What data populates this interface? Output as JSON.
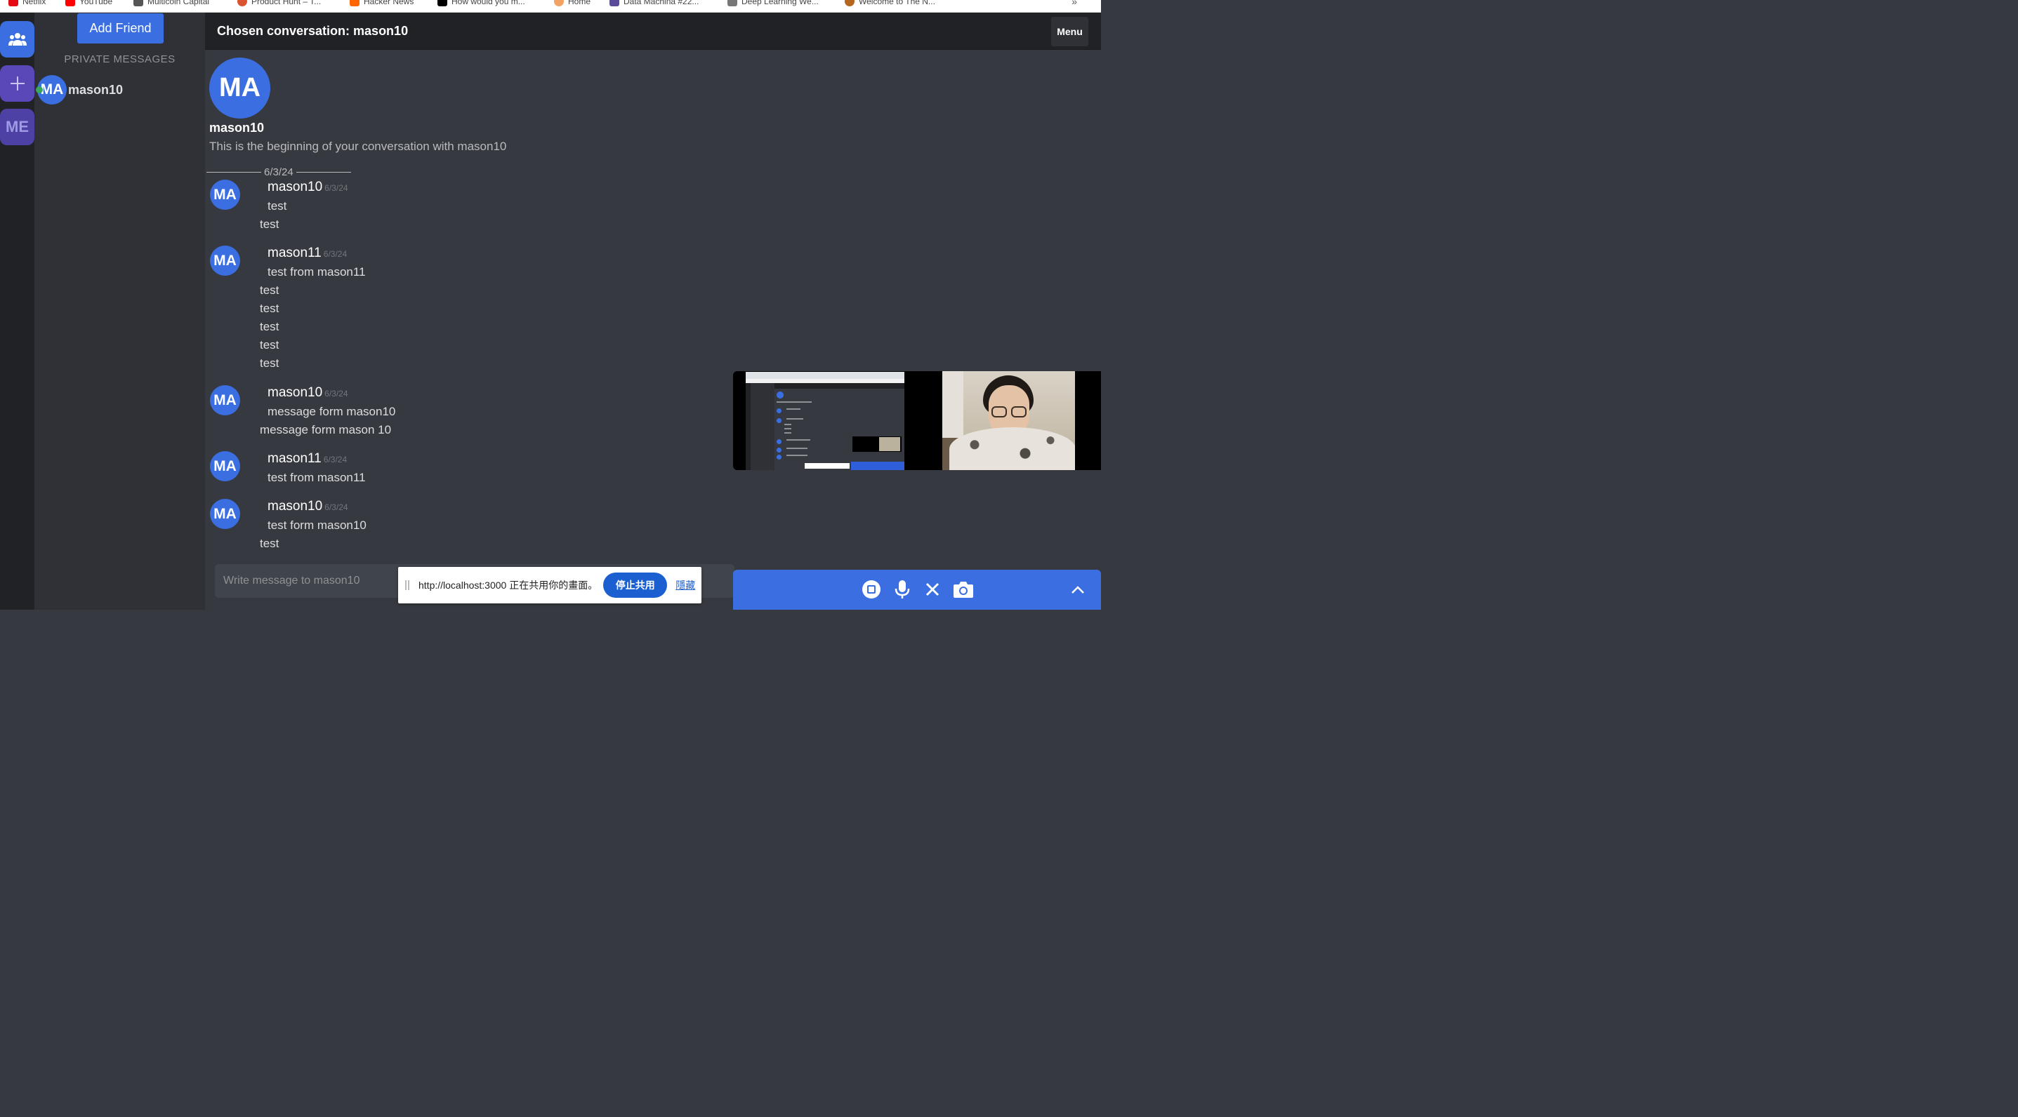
{
  "bookmarks": [
    {
      "label": "Netflix",
      "icon": "netflix-icon",
      "color": "#e50914"
    },
    {
      "label": "YouTube",
      "icon": "youtube-icon",
      "color": "#ff0000"
    },
    {
      "label": "Multicoin Capital",
      "icon": "multicoin-icon",
      "color": "#555555"
    },
    {
      "label": "Product Hunt – T...",
      "icon": "producthunt-icon",
      "color": "#da552f"
    },
    {
      "label": "Hacker News",
      "icon": "hackernews-icon",
      "color": "#ff6600"
    },
    {
      "label": "How would you m...",
      "icon": "medium-icon",
      "color": "#000000"
    },
    {
      "label": "Home",
      "icon": "home-icon",
      "color": "#f4a261"
    },
    {
      "label": "Data Machina #22...",
      "icon": "datamachina-icon",
      "color": "#5b4a9a"
    },
    {
      "label": "Deep Learning We...",
      "icon": "deeplearning-icon",
      "color": "#777777"
    },
    {
      "label": "Welcome to The N...",
      "icon": "welcome-icon",
      "color": "#b5651d"
    }
  ],
  "rail": {
    "friends_icon": "friends-icon",
    "add_icon": "plus-icon",
    "me_label": "ME"
  },
  "dm_panel": {
    "add_friend_label": "Add Friend",
    "section_title": "PRIVATE MESSAGES",
    "items": [
      {
        "avatar": "MA",
        "name": "mason10",
        "online": true
      }
    ]
  },
  "header": {
    "title": "Chosen conversation: mason10",
    "menu_label": "Menu"
  },
  "conversation": {
    "intro_avatar": "MA",
    "intro_name": "mason10",
    "intro_text": "This is the beginning of your conversation with mason10",
    "date_divider": "6/3/24",
    "messages": [
      {
        "avatar": "MA",
        "author": "mason10",
        "time": "6/3/24",
        "first": "test",
        "lines": [
          "test"
        ]
      },
      {
        "avatar": "MA",
        "author": "mason11",
        "time": "6/3/24",
        "first": "test from mason11",
        "lines": [
          "test",
          "test",
          "test",
          "test",
          "test"
        ]
      },
      {
        "avatar": "MA",
        "author": "mason10",
        "time": "6/3/24",
        "first": "message form mason10",
        "lines": [
          "message form mason 10"
        ]
      },
      {
        "avatar": "MA",
        "author": "mason11",
        "time": "6/3/24",
        "first": "test from mason11",
        "lines": []
      },
      {
        "avatar": "MA",
        "author": "mason10",
        "time": "6/3/24",
        "first": "test form mason10",
        "lines": [
          "test"
        ]
      }
    ]
  },
  "input": {
    "placeholder": "Write message to mason10"
  },
  "share_bar": {
    "text": "http://localhost:3000 正在共用你的畫面。",
    "stop_label": "停止共用",
    "hide_label": "隱藏"
  },
  "call": {
    "controls": [
      "stop-record-icon",
      "microphone-icon",
      "close-icon",
      "camera-icon",
      "chevron-up-icon"
    ]
  },
  "colors": {
    "accent": "#3b6ee0",
    "online": "#3ba55d",
    "background": "#36393f",
    "sidebar": "#2f3136",
    "rail": "#202225"
  }
}
